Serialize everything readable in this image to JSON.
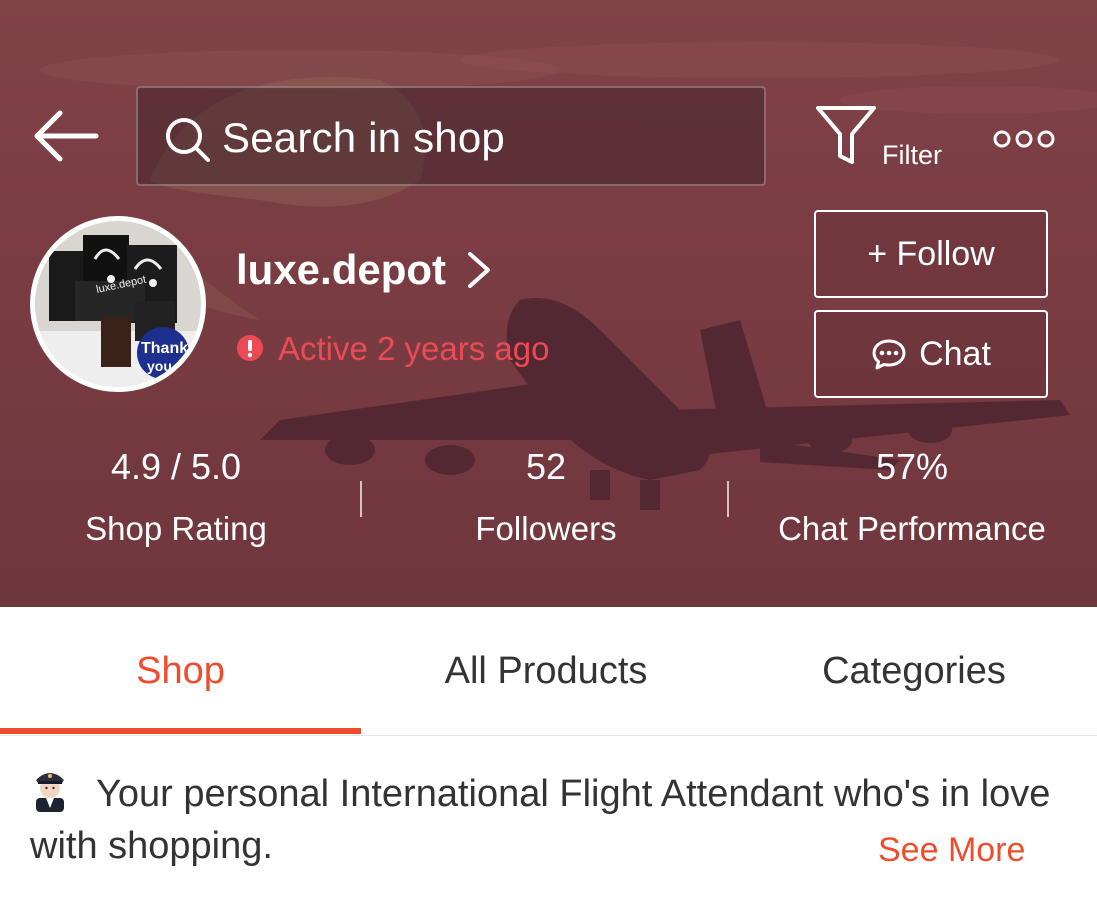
{
  "header": {
    "search_placeholder": "Search in shop",
    "filter_label": "Filter",
    "icons": [
      "back-arrow-icon",
      "search-icon",
      "filter-funnel-icon",
      "more-dots-icon"
    ]
  },
  "shop": {
    "name": "luxe.depot",
    "status": "Active 2 years ago",
    "follow_label": "+ Follow",
    "chat_label": "Chat"
  },
  "stats": [
    {
      "value": "4.9 / 5.0",
      "label": "Shop Rating"
    },
    {
      "value": "52",
      "label": "Followers"
    },
    {
      "value": "57%",
      "label": "Chat Performance"
    }
  ],
  "tabs": [
    {
      "label": "Shop",
      "active": true
    },
    {
      "label": "All Products",
      "active": false
    },
    {
      "label": "Categories",
      "active": false
    }
  ],
  "description": {
    "text": "Your personal International Flight Attendant who's in love with shopping.",
    "see_more": "See More"
  },
  "avatar": {
    "stamp_line1": "Thank",
    "stamp_line2": "you",
    "bag_print": "luxe.depot"
  },
  "colors": {
    "accent": "#ee4d2d",
    "status_red": "#ec4a55",
    "hero_tint": "#854449"
  }
}
